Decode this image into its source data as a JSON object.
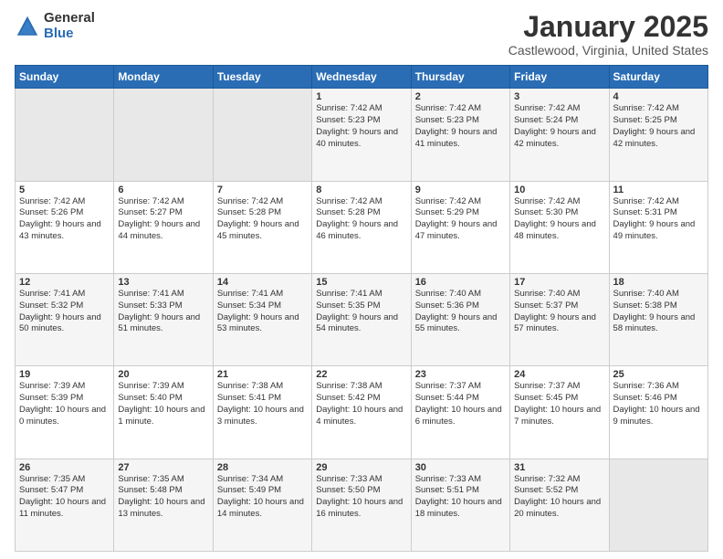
{
  "logo": {
    "general": "General",
    "blue": "Blue"
  },
  "header": {
    "month": "January 2025",
    "location": "Castlewood, Virginia, United States"
  },
  "weekdays": [
    "Sunday",
    "Monday",
    "Tuesday",
    "Wednesday",
    "Thursday",
    "Friday",
    "Saturday"
  ],
  "weeks": [
    [
      {
        "day": "",
        "empty": true
      },
      {
        "day": "",
        "empty": true
      },
      {
        "day": "",
        "empty": true
      },
      {
        "day": "1",
        "sunrise": "7:42 AM",
        "sunset": "5:23 PM",
        "daylight": "9 hours and 40 minutes."
      },
      {
        "day": "2",
        "sunrise": "7:42 AM",
        "sunset": "5:23 PM",
        "daylight": "9 hours and 41 minutes."
      },
      {
        "day": "3",
        "sunrise": "7:42 AM",
        "sunset": "5:24 PM",
        "daylight": "9 hours and 42 minutes."
      },
      {
        "day": "4",
        "sunrise": "7:42 AM",
        "sunset": "5:25 PM",
        "daylight": "9 hours and 42 minutes."
      }
    ],
    [
      {
        "day": "5",
        "sunrise": "7:42 AM",
        "sunset": "5:26 PM",
        "daylight": "9 hours and 43 minutes."
      },
      {
        "day": "6",
        "sunrise": "7:42 AM",
        "sunset": "5:27 PM",
        "daylight": "9 hours and 44 minutes."
      },
      {
        "day": "7",
        "sunrise": "7:42 AM",
        "sunset": "5:28 PM",
        "daylight": "9 hours and 45 minutes."
      },
      {
        "day": "8",
        "sunrise": "7:42 AM",
        "sunset": "5:28 PM",
        "daylight": "9 hours and 46 minutes."
      },
      {
        "day": "9",
        "sunrise": "7:42 AM",
        "sunset": "5:29 PM",
        "daylight": "9 hours and 47 minutes."
      },
      {
        "day": "10",
        "sunrise": "7:42 AM",
        "sunset": "5:30 PM",
        "daylight": "9 hours and 48 minutes."
      },
      {
        "day": "11",
        "sunrise": "7:42 AM",
        "sunset": "5:31 PM",
        "daylight": "9 hours and 49 minutes."
      }
    ],
    [
      {
        "day": "12",
        "sunrise": "7:41 AM",
        "sunset": "5:32 PM",
        "daylight": "9 hours and 50 minutes."
      },
      {
        "day": "13",
        "sunrise": "7:41 AM",
        "sunset": "5:33 PM",
        "daylight": "9 hours and 51 minutes."
      },
      {
        "day": "14",
        "sunrise": "7:41 AM",
        "sunset": "5:34 PM",
        "daylight": "9 hours and 53 minutes."
      },
      {
        "day": "15",
        "sunrise": "7:41 AM",
        "sunset": "5:35 PM",
        "daylight": "9 hours and 54 minutes."
      },
      {
        "day": "16",
        "sunrise": "7:40 AM",
        "sunset": "5:36 PM",
        "daylight": "9 hours and 55 minutes."
      },
      {
        "day": "17",
        "sunrise": "7:40 AM",
        "sunset": "5:37 PM",
        "daylight": "9 hours and 57 minutes."
      },
      {
        "day": "18",
        "sunrise": "7:40 AM",
        "sunset": "5:38 PM",
        "daylight": "9 hours and 58 minutes."
      }
    ],
    [
      {
        "day": "19",
        "sunrise": "7:39 AM",
        "sunset": "5:39 PM",
        "daylight": "10 hours and 0 minutes."
      },
      {
        "day": "20",
        "sunrise": "7:39 AM",
        "sunset": "5:40 PM",
        "daylight": "10 hours and 1 minute."
      },
      {
        "day": "21",
        "sunrise": "7:38 AM",
        "sunset": "5:41 PM",
        "daylight": "10 hours and 3 minutes."
      },
      {
        "day": "22",
        "sunrise": "7:38 AM",
        "sunset": "5:42 PM",
        "daylight": "10 hours and 4 minutes."
      },
      {
        "day": "23",
        "sunrise": "7:37 AM",
        "sunset": "5:44 PM",
        "daylight": "10 hours and 6 minutes."
      },
      {
        "day": "24",
        "sunrise": "7:37 AM",
        "sunset": "5:45 PM",
        "daylight": "10 hours and 7 minutes."
      },
      {
        "day": "25",
        "sunrise": "7:36 AM",
        "sunset": "5:46 PM",
        "daylight": "10 hours and 9 minutes."
      }
    ],
    [
      {
        "day": "26",
        "sunrise": "7:35 AM",
        "sunset": "5:47 PM",
        "daylight": "10 hours and 11 minutes."
      },
      {
        "day": "27",
        "sunrise": "7:35 AM",
        "sunset": "5:48 PM",
        "daylight": "10 hours and 13 minutes."
      },
      {
        "day": "28",
        "sunrise": "7:34 AM",
        "sunset": "5:49 PM",
        "daylight": "10 hours and 14 minutes."
      },
      {
        "day": "29",
        "sunrise": "7:33 AM",
        "sunset": "5:50 PM",
        "daylight": "10 hours and 16 minutes."
      },
      {
        "day": "30",
        "sunrise": "7:33 AM",
        "sunset": "5:51 PM",
        "daylight": "10 hours and 18 minutes."
      },
      {
        "day": "31",
        "sunrise": "7:32 AM",
        "sunset": "5:52 PM",
        "daylight": "10 hours and 20 minutes."
      },
      {
        "day": "",
        "empty": true
      }
    ]
  ]
}
